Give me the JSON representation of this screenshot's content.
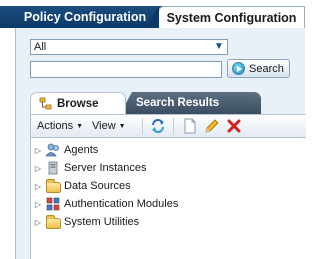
{
  "top_tabs": {
    "policy": "Policy Configuration",
    "system": "System Configuration"
  },
  "search": {
    "scope_value": "All",
    "input_value": "",
    "button_label": "Search"
  },
  "browse_tabs": {
    "browse": "Browse",
    "results": "Search Results"
  },
  "toolbar": {
    "actions": "Actions",
    "view": "View"
  },
  "tree": [
    {
      "label": "Agents",
      "icon": "agents-icon"
    },
    {
      "label": "Server Instances",
      "icon": "server-icon"
    },
    {
      "label": "Data Sources",
      "icon": "folder-icon"
    },
    {
      "label": "Authentication Modules",
      "icon": "modules-icon"
    },
    {
      "label": "System Utilities",
      "icon": "folder-icon"
    }
  ],
  "colors": {
    "accent_dark_tab": "#0c3a68",
    "panel_bg": "#e9f0f7",
    "delete_red": "#d22020"
  }
}
